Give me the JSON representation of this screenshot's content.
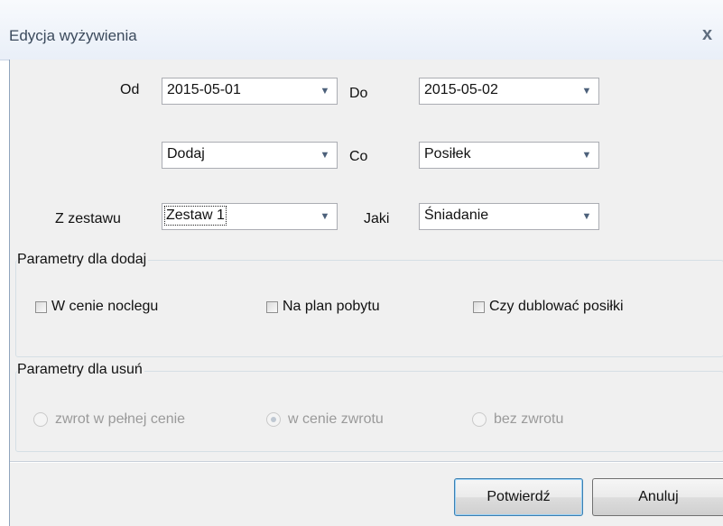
{
  "window": {
    "title": "Edycja wyżywienia",
    "close_glyph": "x"
  },
  "form": {
    "od_label": "Od",
    "od_value": "2015-05-01",
    "do_label": "Do",
    "do_value": "2015-05-02",
    "action_value": "Dodaj",
    "co_label": "Co",
    "co_value": "Posiłek",
    "zestaw_label": "Z zestawu",
    "zestaw_value": "Zestaw 1",
    "jaki_label": "Jaki",
    "jaki_value": "Śniadanie",
    "dropdown_glyph": "▼"
  },
  "group_add": {
    "title": "Parametry dla dodaj",
    "options": [
      {
        "label": "W cenie noclegu",
        "checked": false
      },
      {
        "label": "Na plan pobytu",
        "checked": false
      },
      {
        "label": "Czy dublować posiłki",
        "checked": false
      }
    ]
  },
  "group_remove": {
    "title": "Parametry dla usuń",
    "enabled": false,
    "options": [
      {
        "label": "zwrot w pełnej cenie",
        "selected": false
      },
      {
        "label": "w cenie zwrotu",
        "selected": true
      },
      {
        "label": "bez zwrotu",
        "selected": false
      }
    ]
  },
  "buttons": {
    "confirm_label": "Potwierdź",
    "cancel_label": "Anuluj"
  }
}
